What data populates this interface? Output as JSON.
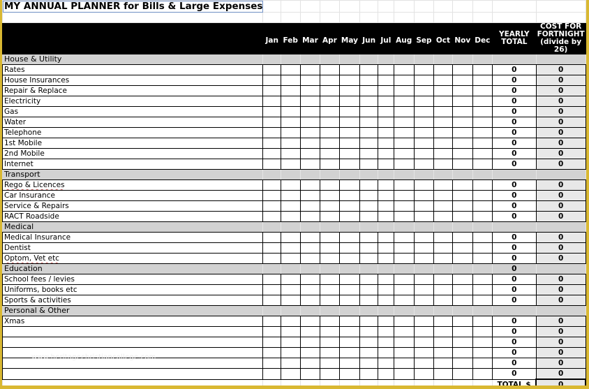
{
  "title": "MY ANNUAL PLANNER for Bills & Large Expenses",
  "columns": {
    "months": [
      "Jan",
      "Feb",
      "Mar",
      "Apr",
      "May",
      "Jun",
      "Jul",
      "Aug",
      "Sep",
      "Oct",
      "Nov",
      "Dec"
    ],
    "yearly_total": "YEARLY TOTAL",
    "fortnight": "COST FOR FORTNIGHT (divide by 26)"
  },
  "categories": [
    {
      "label": "House & Utility",
      "yearly_total": "",
      "items": [
        {
          "label": "Rates",
          "yearly_total": "0",
          "fortnight": "0"
        },
        {
          "label": "House Insurances",
          "yearly_total": "0",
          "fortnight": "0"
        },
        {
          "label": "Repair & Replace",
          "yearly_total": "0",
          "fortnight": "0"
        },
        {
          "label": "Electricity",
          "yearly_total": "0",
          "fortnight": "0"
        },
        {
          "label": "Gas",
          "yearly_total": "0",
          "fortnight": "0"
        },
        {
          "label": "Water",
          "yearly_total": "0",
          "fortnight": "0"
        },
        {
          "label": "Telephone",
          "yearly_total": "0",
          "fortnight": "0"
        },
        {
          "label": "1st Mobile",
          "yearly_total": "0",
          "fortnight": "0"
        },
        {
          "label": "2nd Mobile",
          "yearly_total": "0",
          "fortnight": "0"
        },
        {
          "label": "Internet",
          "yearly_total": "0",
          "fortnight": "0"
        }
      ]
    },
    {
      "label": "Transport",
      "yearly_total": "",
      "items": [
        {
          "label": "Rego & Licences",
          "yearly_total": "0",
          "fortnight": "0"
        },
        {
          "label": "Car Insurance",
          "yearly_total": "0",
          "fortnight": "0"
        },
        {
          "label": "Service & Repairs",
          "yearly_total": "0",
          "fortnight": "0"
        },
        {
          "label": "RACT Roadside",
          "yearly_total": "0",
          "fortnight": "0"
        }
      ]
    },
    {
      "label": "Medical",
      "yearly_total": "",
      "items": [
        {
          "label": "Medical  Insurance",
          "yearly_total": "0",
          "fortnight": "0"
        },
        {
          "label": "Dentist",
          "yearly_total": "0",
          "fortnight": "0"
        },
        {
          "label": "Optom, Vet etc",
          "yearly_total": "0",
          "fortnight": "0"
        }
      ]
    },
    {
      "label": "Education",
      "yearly_total": "0",
      "items": [
        {
          "label": "School fees / levies",
          "yearly_total": "0",
          "fortnight": "0"
        },
        {
          "label": "Uniforms, books etc",
          "yearly_total": "0",
          "fortnight": "0"
        },
        {
          "label": "Sports & activities",
          "yearly_total": "0",
          "fortnight": "0"
        }
      ]
    },
    {
      "label": "Personal & Other",
      "yearly_total": "",
      "items": [
        {
          "label": "Xmas",
          "yearly_total": "0",
          "fortnight": "0"
        },
        {
          "label": "",
          "yearly_total": "0",
          "fortnight": "0"
        },
        {
          "label": "",
          "yearly_total": "0",
          "fortnight": "0"
        },
        {
          "label": "",
          "yearly_total": "0",
          "fortnight": "0"
        },
        {
          "label": "",
          "yearly_total": "0",
          "fortnight": "0"
        },
        {
          "label": "",
          "yearly_total": "0",
          "fortnight": "0"
        }
      ]
    }
  ],
  "total": {
    "label": "TOTAL $",
    "value": "0"
  },
  "watermark": "www.heritagechristiancollege.com"
}
